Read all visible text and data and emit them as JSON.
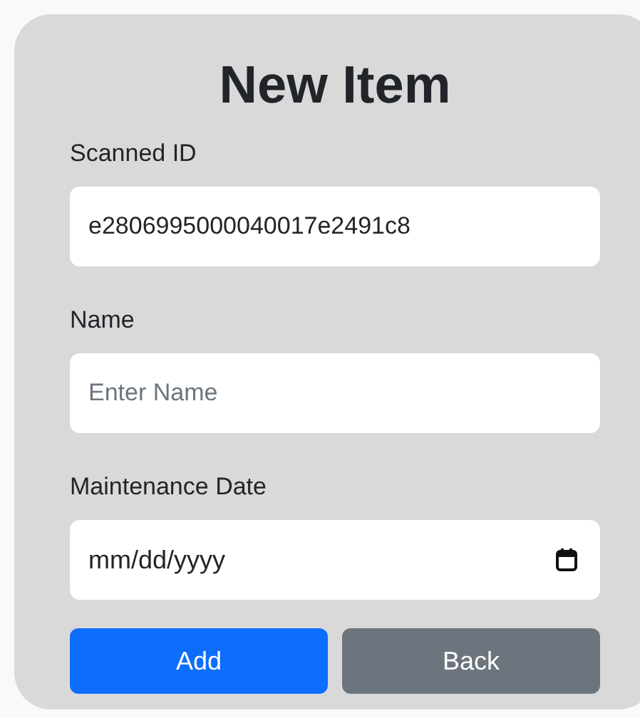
{
  "title": "New Item",
  "fields": [
    {
      "kind": "text",
      "label": "Scanned ID",
      "value": "e2806995000040017e2491c8"
    },
    {
      "kind": "text",
      "label": "Name",
      "placeholder": "Enter Name"
    },
    {
      "kind": "date",
      "label": "Maintenance Date",
      "placeholder": "mm/dd/yyyy"
    }
  ],
  "buttons": [
    {
      "kind": "primary",
      "label": "Add"
    },
    {
      "kind": "secondary",
      "label": "Back"
    }
  ]
}
